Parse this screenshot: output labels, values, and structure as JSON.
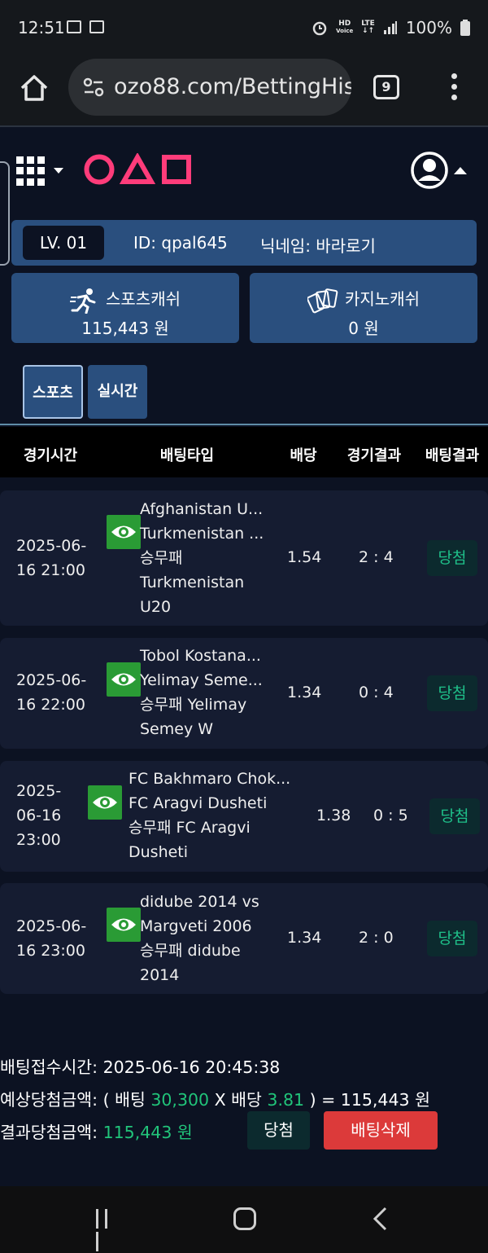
{
  "status_bar": {
    "time": "12:51",
    "battery": "100%",
    "icons": [
      "calendar-icon",
      "image-icon",
      "alarm-icon",
      "hd-voice-icon",
      "lte-icon",
      "signal-icon",
      "battery-icon"
    ],
    "hd_label": "HD",
    "voice_label": "Voice",
    "lte_label": "LTE"
  },
  "browser": {
    "url": "ozo88.com/BettingHistory",
    "tab_count": "9"
  },
  "account": {
    "level": "LV. 01",
    "id": "ID: qpal645",
    "nickname": "닉네임: 바라로기"
  },
  "wallet": {
    "sports_label": "스포츠캐쉬",
    "sports_value": "115,443 원",
    "casino_label": "카지노캐쉬",
    "casino_value": "0 원"
  },
  "tabs": [
    {
      "label": "스포츠",
      "active": true
    },
    {
      "label": "실시간",
      "active": false
    }
  ],
  "table": {
    "headers": [
      "경기시간",
      "배팅타입",
      "배당",
      "경기결과",
      "배팅결과"
    ],
    "rows": [
      {
        "date_lines": [
          "2025-06-",
          "16 21:00"
        ],
        "team_lines": [
          "Afghanistan U...",
          "Turkmenistan ...",
          "승무패",
          "Turkmenistan",
          "U20"
        ],
        "odds": "1.54",
        "score": "2 : 4",
        "result": "당첨"
      },
      {
        "date_lines": [
          "2025-06-",
          "16 22:00"
        ],
        "team_lines": [
          "Tobol Kostana...",
          "Yelimay Seme...",
          "승무패 Yelimay",
          "Semey W"
        ],
        "odds": "1.34",
        "score": "0 : 4",
        "result": "당첨"
      },
      {
        "date_lines": [
          "2025-",
          "06-16",
          "23:00"
        ],
        "team_lines": [
          "FC Bakhmaro Chok...",
          "FC Aragvi Dusheti",
          "승무패 FC Aragvi",
          "Dusheti"
        ],
        "odds": "1.38",
        "score": "0 : 5",
        "result": "당첨"
      },
      {
        "date_lines": [
          "2025-06-",
          "16 23:00"
        ],
        "team_lines": [
          "didube 2014 vs",
          "Margveti 2006",
          "승무패 didube",
          "2014"
        ],
        "odds": "1.34",
        "score": "2 : 0",
        "result": "당첨"
      }
    ]
  },
  "summary": {
    "received_label": "배팅접수시간: ",
    "received_time": "2025-06-16 20:45:38",
    "expected_prefix": "예상당첨금액: ( 배팅 ",
    "stake": "30,300",
    "expected_mid": " X 배당 ",
    "total_odds": "3.81",
    "expected_suffix": " ) = 115,443 원",
    "result_label": "결과당첨금액: ",
    "result_amount": "115,443 원",
    "status_button": "당첨",
    "delete_button": "배팅삭제"
  },
  "colors": {
    "background": "#0c1222",
    "panel": "#2a4f7e",
    "card": "#151c31",
    "accent_green": "#21c47a",
    "eye_green": "#2a9b35",
    "delete_red": "#dc3a3a",
    "logo_pink": "#ff3c7a"
  }
}
